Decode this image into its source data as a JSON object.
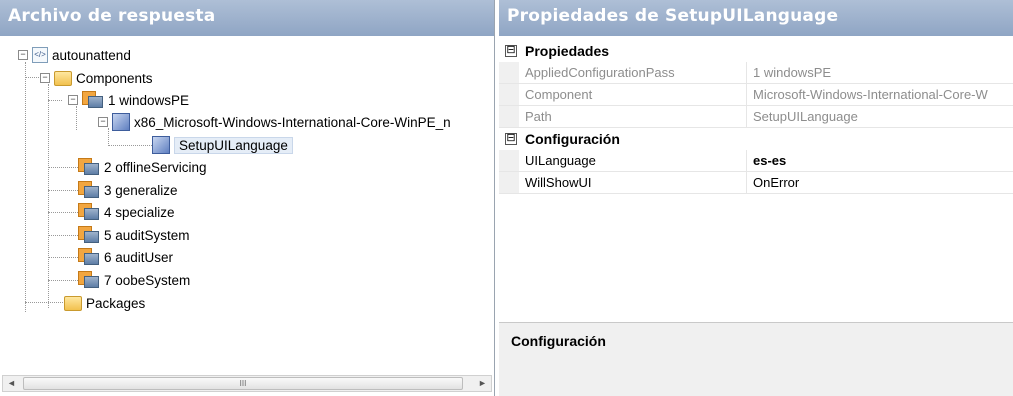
{
  "left_pane": {
    "title": "Archivo de respuesta",
    "tree": {
      "root": "autounattend",
      "components": "Components",
      "pass1": "1 windowsPE",
      "component": "x86_Microsoft-Windows-International-Core-WinPE_n",
      "setting": "SetupUILanguage",
      "pass2": "2 offlineServicing",
      "pass3": "3 generalize",
      "pass4": "4 specialize",
      "pass5": "5 auditSystem",
      "pass6": "6 auditUser",
      "pass7": "7 oobeSystem",
      "packages": "Packages"
    },
    "scrollbar": {
      "left_arrow": "◄",
      "right_arrow": "►",
      "thumb_grip": "III"
    }
  },
  "right_pane": {
    "title": "Propiedades de SetupUILanguage",
    "categories": [
      {
        "label": "Propiedades",
        "toggle": "⊟",
        "rows": [
          {
            "name": "AppliedConfigurationPass",
            "value": "1 windowsPE"
          },
          {
            "name": "Component",
            "value": "Microsoft-Windows-International-Core-W"
          },
          {
            "name": "Path",
            "value": "SetupUILanguage"
          }
        ]
      },
      {
        "label": "Configuración",
        "toggle": "⊟",
        "rows": [
          {
            "name": "UILanguage",
            "value": "es-es"
          },
          {
            "name": "WillShowUI",
            "value": "OnError"
          }
        ]
      }
    ],
    "description_title": "Configuración"
  },
  "colors": {
    "header": "#8fa5c4",
    "selection": "#e5edf7"
  }
}
